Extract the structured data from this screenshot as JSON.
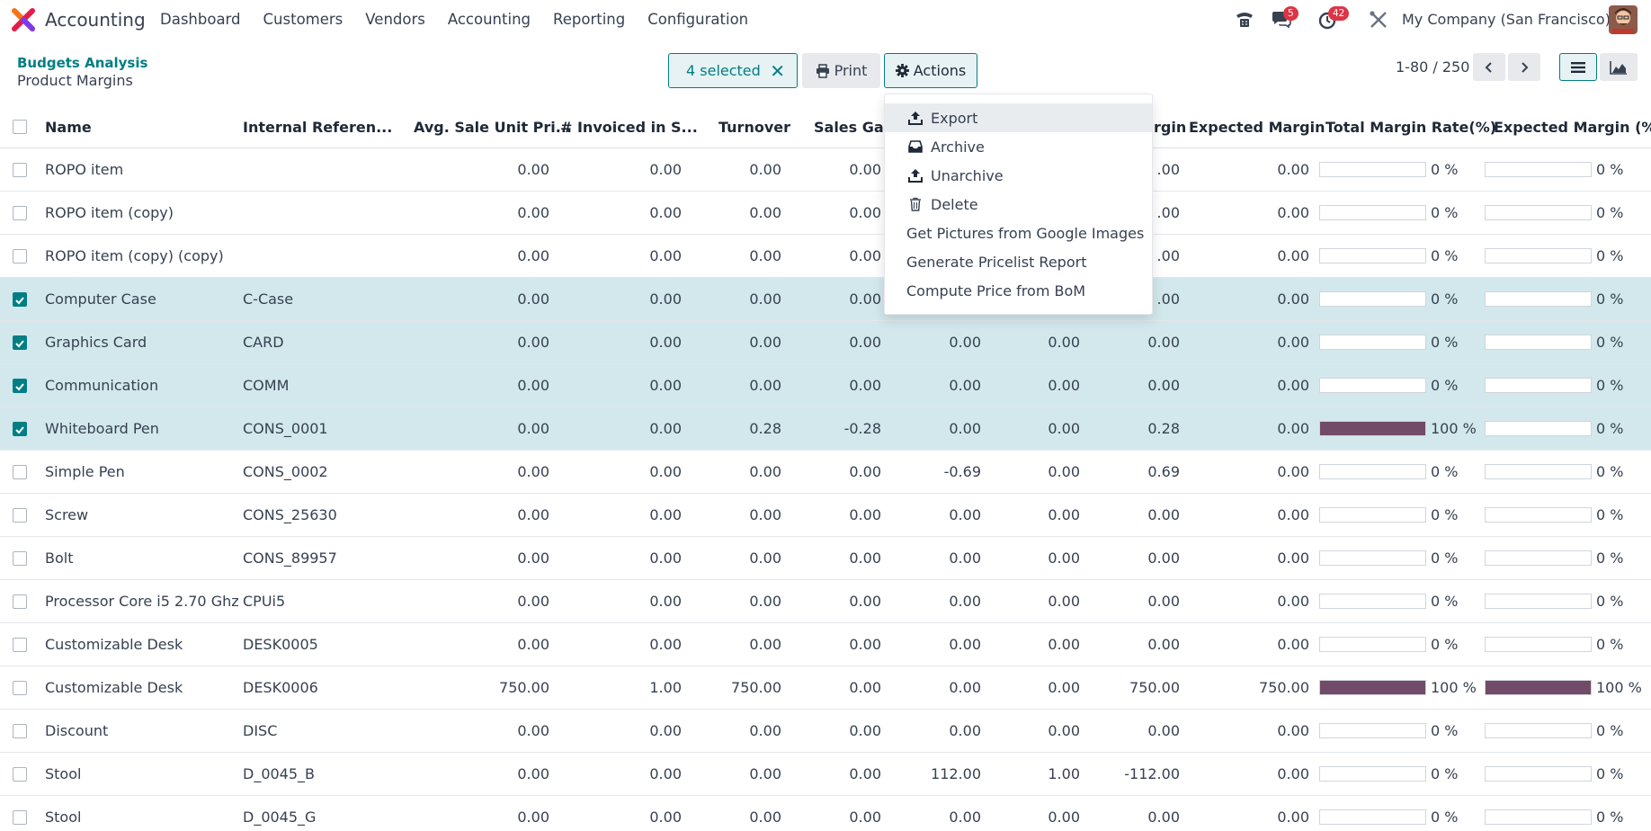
{
  "app": {
    "name": "Accounting"
  },
  "menu": [
    "Dashboard",
    "Customers",
    "Vendors",
    "Accounting",
    "Reporting",
    "Configuration"
  ],
  "nav": {
    "messages_badge": "5",
    "activities_badge": "42",
    "company": "My Company (San Francisco)"
  },
  "breadcrumb": {
    "parent": "Budgets Analysis",
    "current": "Product Margins"
  },
  "toolbar": {
    "selected_label": "4 selected",
    "print_label": "Print",
    "actions_label": "Actions"
  },
  "pager": {
    "value": "1-80 / 250"
  },
  "columns": [
    "Name",
    "Internal Referen...",
    "Avg. Sale Unit Pri...",
    "# Invoiced in S...",
    "Turnover",
    "Sales Gap",
    "rgin",
    "Expected Margin",
    "Total Margin Rate(%)",
    "Expected Margin (%)"
  ],
  "actions_menu": [
    {
      "label": "Export",
      "icon": "upload-icon"
    },
    {
      "label": "Archive",
      "icon": "archive-icon"
    },
    {
      "label": "Unarchive",
      "icon": "unarchive-icon"
    },
    {
      "label": "Delete",
      "icon": "trash-icon"
    },
    {
      "label": "Get Pictures from Google Images",
      "icon": ""
    },
    {
      "label": "Generate Pricelist Report",
      "icon": ""
    },
    {
      "label": "Compute Price from BoM",
      "icon": ""
    }
  ],
  "rows": [
    {
      "checked": false,
      "name": "ROPO item",
      "ref": "",
      "avg": "0.00",
      "inv": "0.00",
      "turnover": "0.00",
      "gap": "0.00",
      "c7": "",
      "c8": "",
      "margin": ".00",
      "exp_margin": "0.00",
      "tmr_label": "0 %",
      "tmr": 0,
      "emr_label": "0 %",
      "emr": 0
    },
    {
      "checked": false,
      "name": "ROPO item (copy)",
      "ref": "",
      "avg": "0.00",
      "inv": "0.00",
      "turnover": "0.00",
      "gap": "0.00",
      "c7": "",
      "c8": "",
      "margin": ".00",
      "exp_margin": "0.00",
      "tmr_label": "0 %",
      "tmr": 0,
      "emr_label": "0 %",
      "emr": 0
    },
    {
      "checked": false,
      "name": "ROPO item (copy) (copy)",
      "ref": "",
      "avg": "0.00",
      "inv": "0.00",
      "turnover": "0.00",
      "gap": "0.00",
      "c7": "",
      "c8": "",
      "margin": ".00",
      "exp_margin": "0.00",
      "tmr_label": "0 %",
      "tmr": 0,
      "emr_label": "0 %",
      "emr": 0
    },
    {
      "checked": true,
      "name": "Computer Case",
      "ref": "C-Case",
      "avg": "0.00",
      "inv": "0.00",
      "turnover": "0.00",
      "gap": "0.00",
      "c7": "",
      "c8": "",
      "margin": ".00",
      "exp_margin": "0.00",
      "tmr_label": "0 %",
      "tmr": 0,
      "emr_label": "0 %",
      "emr": 0
    },
    {
      "checked": true,
      "name": "Graphics Card",
      "ref": "CARD",
      "avg": "0.00",
      "inv": "0.00",
      "turnover": "0.00",
      "gap": "0.00",
      "c7": "0.00",
      "c8": "0.00",
      "margin": "0.00",
      "exp_margin": "0.00",
      "tmr_label": "0 %",
      "tmr": 0,
      "emr_label": "0 %",
      "emr": 0
    },
    {
      "checked": true,
      "name": "Communication",
      "ref": "COMM",
      "avg": "0.00",
      "inv": "0.00",
      "turnover": "0.00",
      "gap": "0.00",
      "c7": "0.00",
      "c8": "0.00",
      "margin": "0.00",
      "exp_margin": "0.00",
      "tmr_label": "0 %",
      "tmr": 0,
      "emr_label": "0 %",
      "emr": 0
    },
    {
      "checked": true,
      "name": "Whiteboard Pen",
      "ref": "CONS_0001",
      "avg": "0.00",
      "inv": "0.00",
      "turnover": "0.28",
      "gap": "-0.28",
      "c7": "0.00",
      "c8": "0.00",
      "margin": "0.28",
      "exp_margin": "0.00",
      "tmr_label": "100 %",
      "tmr": 1,
      "emr_label": "0 %",
      "emr": 0
    },
    {
      "checked": false,
      "name": "Simple Pen",
      "ref": "CONS_0002",
      "avg": "0.00",
      "inv": "0.00",
      "turnover": "0.00",
      "gap": "0.00",
      "c7": "-0.69",
      "c8": "0.00",
      "margin": "0.69",
      "exp_margin": "0.00",
      "tmr_label": "0 %",
      "tmr": 0,
      "emr_label": "0 %",
      "emr": 0
    },
    {
      "checked": false,
      "name": "Screw",
      "ref": "CONS_25630",
      "avg": "0.00",
      "inv": "0.00",
      "turnover": "0.00",
      "gap": "0.00",
      "c7": "0.00",
      "c8": "0.00",
      "margin": "0.00",
      "exp_margin": "0.00",
      "tmr_label": "0 %",
      "tmr": 0,
      "emr_label": "0 %",
      "emr": 0
    },
    {
      "checked": false,
      "name": "Bolt",
      "ref": "CONS_89957",
      "avg": "0.00",
      "inv": "0.00",
      "turnover": "0.00",
      "gap": "0.00",
      "c7": "0.00",
      "c8": "0.00",
      "margin": "0.00",
      "exp_margin": "0.00",
      "tmr_label": "0 %",
      "tmr": 0,
      "emr_label": "0 %",
      "emr": 0
    },
    {
      "checked": false,
      "name": "Processor Core i5 2.70 Ghz",
      "ref": "CPUi5",
      "avg": "0.00",
      "inv": "0.00",
      "turnover": "0.00",
      "gap": "0.00",
      "c7": "0.00",
      "c8": "0.00",
      "margin": "0.00",
      "exp_margin": "0.00",
      "tmr_label": "0 %",
      "tmr": 0,
      "emr_label": "0 %",
      "emr": 0
    },
    {
      "checked": false,
      "name": "Customizable Desk",
      "ref": "DESK0005",
      "avg": "0.00",
      "inv": "0.00",
      "turnover": "0.00",
      "gap": "0.00",
      "c7": "0.00",
      "c8": "0.00",
      "margin": "0.00",
      "exp_margin": "0.00",
      "tmr_label": "0 %",
      "tmr": 0,
      "emr_label": "0 %",
      "emr": 0
    },
    {
      "checked": false,
      "name": "Customizable Desk",
      "ref": "DESK0006",
      "avg": "750.00",
      "inv": "1.00",
      "turnover": "750.00",
      "gap": "0.00",
      "c7": "0.00",
      "c8": "0.00",
      "margin": "750.00",
      "exp_margin": "750.00",
      "tmr_label": "100 %",
      "tmr": 1,
      "emr_label": "100 %",
      "emr": 1
    },
    {
      "checked": false,
      "name": "Discount",
      "ref": "DISC",
      "avg": "0.00",
      "inv": "0.00",
      "turnover": "0.00",
      "gap": "0.00",
      "c7": "0.00",
      "c8": "0.00",
      "margin": "0.00",
      "exp_margin": "0.00",
      "tmr_label": "0 %",
      "tmr": 0,
      "emr_label": "0 %",
      "emr": 0
    },
    {
      "checked": false,
      "name": "Stool",
      "ref": "D_0045_B",
      "avg": "0.00",
      "inv": "0.00",
      "turnover": "0.00",
      "gap": "0.00",
      "c7": "112.00",
      "c8": "1.00",
      "margin": "-112.00",
      "exp_margin": "0.00",
      "tmr_label": "0 %",
      "tmr": 0,
      "emr_label": "0 %",
      "emr": 0
    },
    {
      "checked": false,
      "name": "Stool",
      "ref": "D_0045_G",
      "avg": "0.00",
      "inv": "0.00",
      "turnover": "0.00",
      "gap": "0.00",
      "c7": "0.00",
      "c8": "0.00",
      "margin": "0.00",
      "exp_margin": "0.00",
      "tmr_label": "0 %",
      "tmr": 0,
      "emr_label": "0 %",
      "emr": 0
    }
  ],
  "colors": {
    "accent": "#017e84",
    "bar_fill": "#714b67",
    "selected_row": "#d2e8ec"
  }
}
